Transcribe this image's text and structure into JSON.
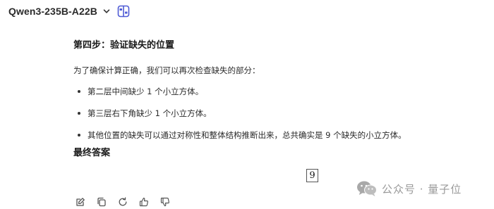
{
  "header": {
    "model_name": "Qwen3-235B-A22B"
  },
  "message": {
    "heading": "第四步：验证缺失的位置",
    "paragraph": "为了确保计算正确，我们可以再次检查缺失的部分：",
    "bullets": [
      "第二层中间缺少 1 个小立方体。",
      "第三层右下角缺少 1 个小立方体。",
      "其他位置的缺失可以通过对称性和整体结构推断出来，总共确实是 9 个缺失的小立方体。"
    ],
    "final_heading": "最终答案",
    "answer": "9"
  },
  "actions": {
    "icons": [
      "edit-icon",
      "copy-icon",
      "regenerate-icon",
      "thumbs-up-icon",
      "thumbs-down-icon"
    ]
  },
  "watermark": {
    "text": "公众号 · 量子位"
  },
  "colors": {
    "accent": "#4f5bd5",
    "text": "#2b2b2b",
    "watermark": "#9a9a9a"
  }
}
